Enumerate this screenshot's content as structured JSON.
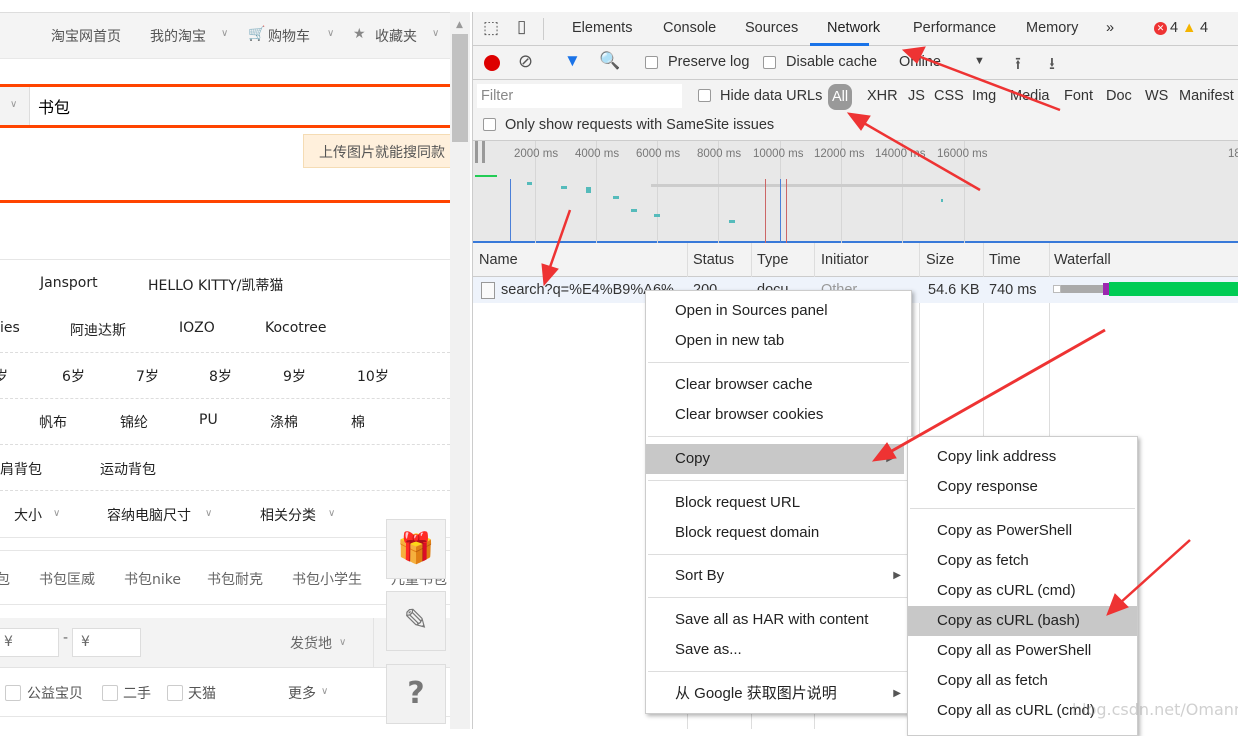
{
  "page": {
    "topnav": {
      "home": "淘宝网首页",
      "my_taobao": "我的淘宝",
      "cart": "购物车",
      "favorites": "收藏夹"
    },
    "search": {
      "value": "书包",
      "tooltip": "上传图片就能搜同款"
    },
    "brands_row1": [
      "Jansport",
      "HELLO KITTY/凯蒂猫"
    ],
    "brands_row2": [
      "ies",
      "阿迪达斯",
      "IOZO",
      "Kocotree"
    ],
    "ages": [
      "岁",
      "6岁",
      "7岁",
      "8岁",
      "9岁",
      "10岁"
    ],
    "materials": [
      "帆布",
      "锦纶",
      "PU",
      "涤棉",
      "棉"
    ],
    "styles": [
      "单肩背包",
      "运动背包"
    ],
    "dropdowns": [
      "大小",
      "容纳电脑尺寸",
      "相关分类"
    ],
    "related": [
      "包",
      "书包匡威",
      "书包nike",
      "书包耐克",
      "书包小学生",
      "儿童书包"
    ],
    "price": {
      "min_placeholder": "¥",
      "sep": "-",
      "max_placeholder": "¥",
      "ship_from": "发货地"
    },
    "checks": [
      "公益宝贝",
      "二手",
      "天猫"
    ],
    "more": "更多",
    "float_buttons": [
      "gift-icon",
      "pencil-icon",
      "question-icon"
    ]
  },
  "devtools": {
    "tabs": [
      "Elements",
      "Console",
      "Sources",
      "Network",
      "Performance",
      "Memory"
    ],
    "active_tab": "Network",
    "more_tabs": "»",
    "errors": "4",
    "warnings": "4",
    "toolbar": {
      "preserve_log": "Preserve log",
      "disable_cache": "Disable cache",
      "throttle": "Online"
    },
    "filter": {
      "placeholder": "Filter",
      "hide_data_urls": "Hide data URLs",
      "types": [
        "All",
        "XHR",
        "JS",
        "CSS",
        "Img",
        "Media",
        "Font",
        "Doc",
        "WS",
        "Manifest"
      ],
      "samesite": "Only show requests with SameSite issues"
    },
    "timeline_ticks": [
      "2000 ms",
      "4000 ms",
      "6000 ms",
      "8000 ms",
      "10000 ms",
      "12000 ms",
      "14000 ms",
      "16000 ms",
      "18"
    ],
    "columns": [
      "Name",
      "Status",
      "Type",
      "Initiator",
      "Size",
      "Time",
      "Waterfall"
    ],
    "request": {
      "name": "search?q=%E4%B9%A6%",
      "status": "200",
      "type": "docu",
      "initiator": "Other",
      "size": "54.6 KB",
      "time": "740 ms"
    },
    "accent": "#1a73e8"
  },
  "context_menu": {
    "groups": [
      [
        "Open in Sources panel",
        "Open in new tab"
      ],
      [
        "Clear browser cache",
        "Clear browser cookies"
      ],
      [
        "Copy"
      ],
      [
        "Block request URL",
        "Block request domain"
      ],
      [
        "Sort By"
      ],
      [
        "Save all as HAR with content",
        "Save as..."
      ],
      [
        "从 Google 获取图片说明"
      ]
    ],
    "highlighted": "Copy"
  },
  "copy_submenu": {
    "groups": [
      [
        "Copy link address",
        "Copy response"
      ],
      [
        "Copy as PowerShell",
        "Copy as fetch",
        "Copy as cURL (cmd)",
        "Copy as cURL (bash)",
        "Copy all as PowerShell",
        "Copy all as fetch",
        "Copy all as cURL (cmd)"
      ]
    ],
    "highlighted": "Copy as cURL (bash)"
  },
  "watermark": "blog.csdn.net/Omann",
  "annotation_color": "#ee3333"
}
